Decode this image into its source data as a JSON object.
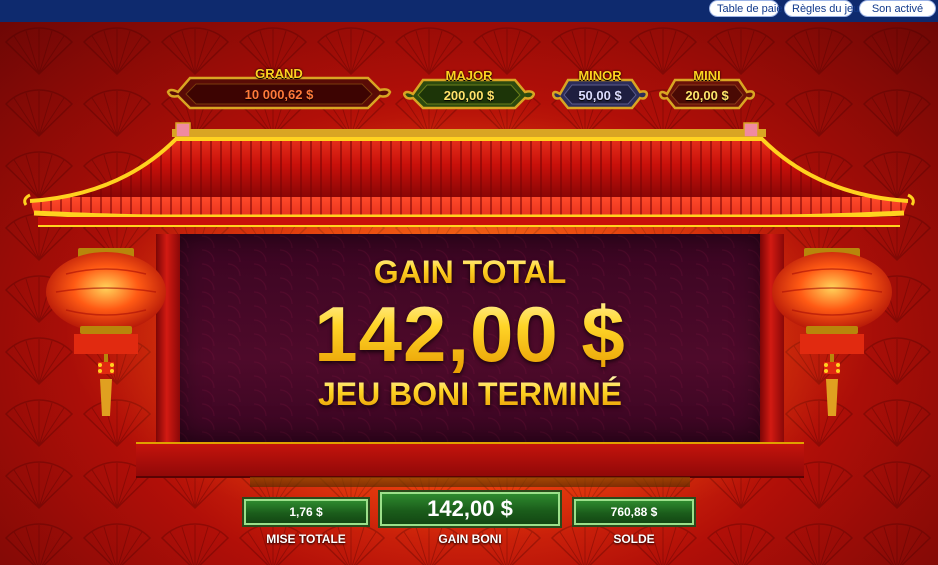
{
  "topbar": {
    "buttons": [
      {
        "label": "Table de paie"
      },
      {
        "label": "Règles du jeu"
      },
      {
        "label": "Son activé"
      }
    ]
  },
  "jackpots": [
    {
      "label": "GRAND",
      "value": "10 000,62 $",
      "label_color": "#ffd21f",
      "value_color": "#ff7a3a"
    },
    {
      "label": "MAJOR",
      "value": "200,00 $",
      "label_color": "#ffd21f",
      "value_color": "#ffe36a"
    },
    {
      "label": "MINOR",
      "value": "50,00 $",
      "label_color": "#ffd21f",
      "value_color": "#dcdcff"
    },
    {
      "label": "MINI",
      "value": "20,00 $",
      "label_color": "#ffd21f",
      "value_color": "#ffe36a"
    }
  ],
  "bonus_result": {
    "title": "GAIN TOTAL",
    "amount": "142,00 $",
    "subtitle": "JEU BONI TERMINÉ"
  },
  "stats": [
    {
      "value": "1,76 $",
      "label": "MISE TOTALE"
    },
    {
      "value": "142,00 $",
      "label": "GAIN BONI"
    },
    {
      "value": "760,88 $",
      "label": "SOLDE"
    }
  ],
  "colors": {
    "accent_gold": "#ffd21f",
    "stat_green": "#2e8a2e",
    "topbar": "#0e2a6e"
  }
}
